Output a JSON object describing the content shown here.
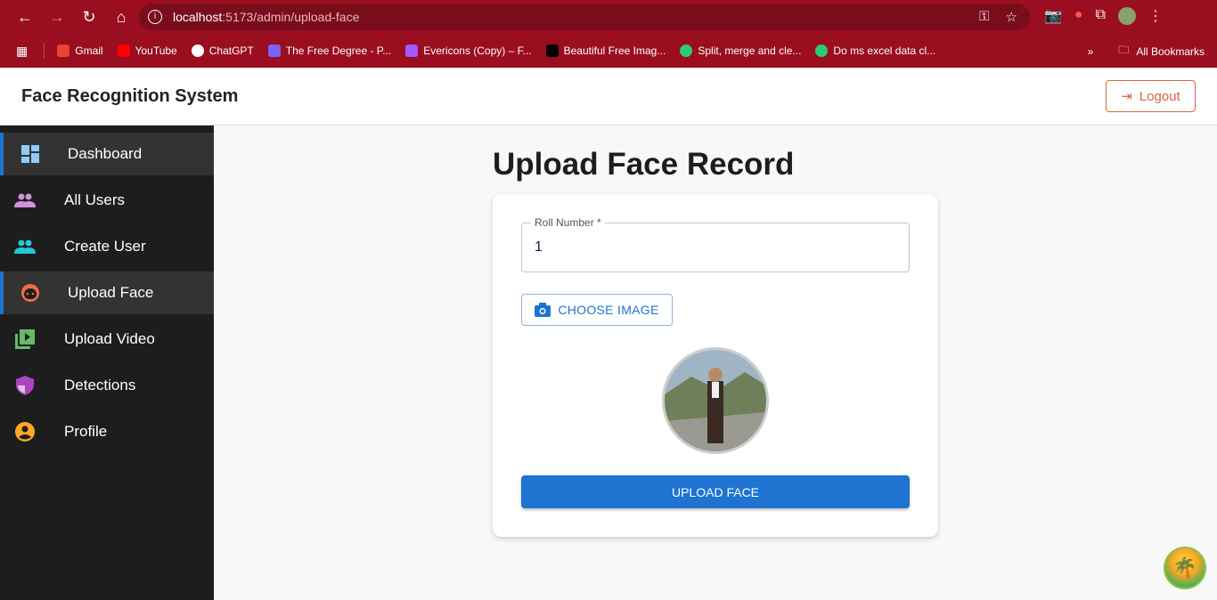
{
  "browser": {
    "url_host": "localhost",
    "url_path": ":5173/admin/upload-face",
    "bookmarks": [
      {
        "label": "Gmail",
        "color": "#ea4335"
      },
      {
        "label": "YouTube",
        "color": "#ff0000"
      },
      {
        "label": "ChatGPT",
        "color": "#ffffff"
      },
      {
        "label": "The Free Degree - P...",
        "color": "#7b61ff"
      },
      {
        "label": "Evericons (Copy) – F...",
        "color": "#a259ff"
      },
      {
        "label": "Beautiful Free Imag...",
        "color": "#000000"
      },
      {
        "label": "Split, merge and cle...",
        "color": "#2ecc71"
      },
      {
        "label": "Do ms excel data cl...",
        "color": "#2ecc71"
      }
    ],
    "all_bookmarks": "All Bookmarks"
  },
  "header": {
    "title": "Face Recognition System",
    "logout": "Logout",
    "accent": "#d9653f"
  },
  "sidebar": {
    "items": [
      {
        "label": "Dashboard",
        "icon": "dashboard-icon",
        "color": "#90caf9",
        "active": true
      },
      {
        "label": "All Users",
        "icon": "people-icon",
        "color": "#ce93d8"
      },
      {
        "label": "Create User",
        "icon": "people-icon",
        "color": "#26c6da"
      },
      {
        "label": "Upload Face",
        "icon": "face-icon",
        "color": "#ef6c4a",
        "active": true
      },
      {
        "label": "Upload Video",
        "icon": "video-library-icon",
        "color": "#66bb6a"
      },
      {
        "label": "Detections",
        "icon": "shield-icon",
        "color": "#ab47bc"
      },
      {
        "label": "Profile",
        "icon": "account-circle-icon",
        "color": "#ffa726"
      }
    ]
  },
  "main": {
    "title": "Upload Face Record",
    "roll_label": "Roll Number *",
    "roll_value": "1",
    "choose_image": "CHOOSE IMAGE",
    "upload_button": "UPLOAD FACE",
    "primary_color": "#1e74d0"
  }
}
